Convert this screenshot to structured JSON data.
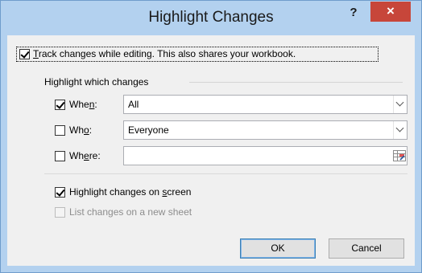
{
  "dialog": {
    "title": "Highlight Changes",
    "help_label": "?",
    "close_label": "×"
  },
  "track": {
    "checked": true,
    "pre": "",
    "key": "T",
    "post": "rack changes while editing. This also shares your workbook."
  },
  "group": {
    "label": "Highlight which changes"
  },
  "when": {
    "checked": true,
    "pre": "Whe",
    "key": "n",
    "post": ":",
    "value": "All"
  },
  "who": {
    "checked": false,
    "pre": "Wh",
    "key": "o",
    "post": ":",
    "value": "Everyone"
  },
  "where": {
    "checked": false,
    "pre": "Wh",
    "key": "e",
    "post": "re:",
    "value": ""
  },
  "highlight_screen": {
    "checked": true,
    "pre": "Highlight changes on ",
    "key": "s",
    "post": "creen"
  },
  "list_changes": {
    "checked": false,
    "disabled": true,
    "label": "List changes on a new sheet"
  },
  "buttons": {
    "ok": "OK",
    "cancel": "Cancel"
  },
  "colors": {
    "frame": "#b3d1ef",
    "close_button": "#c7463a",
    "client_background": "#f0f0f0"
  }
}
